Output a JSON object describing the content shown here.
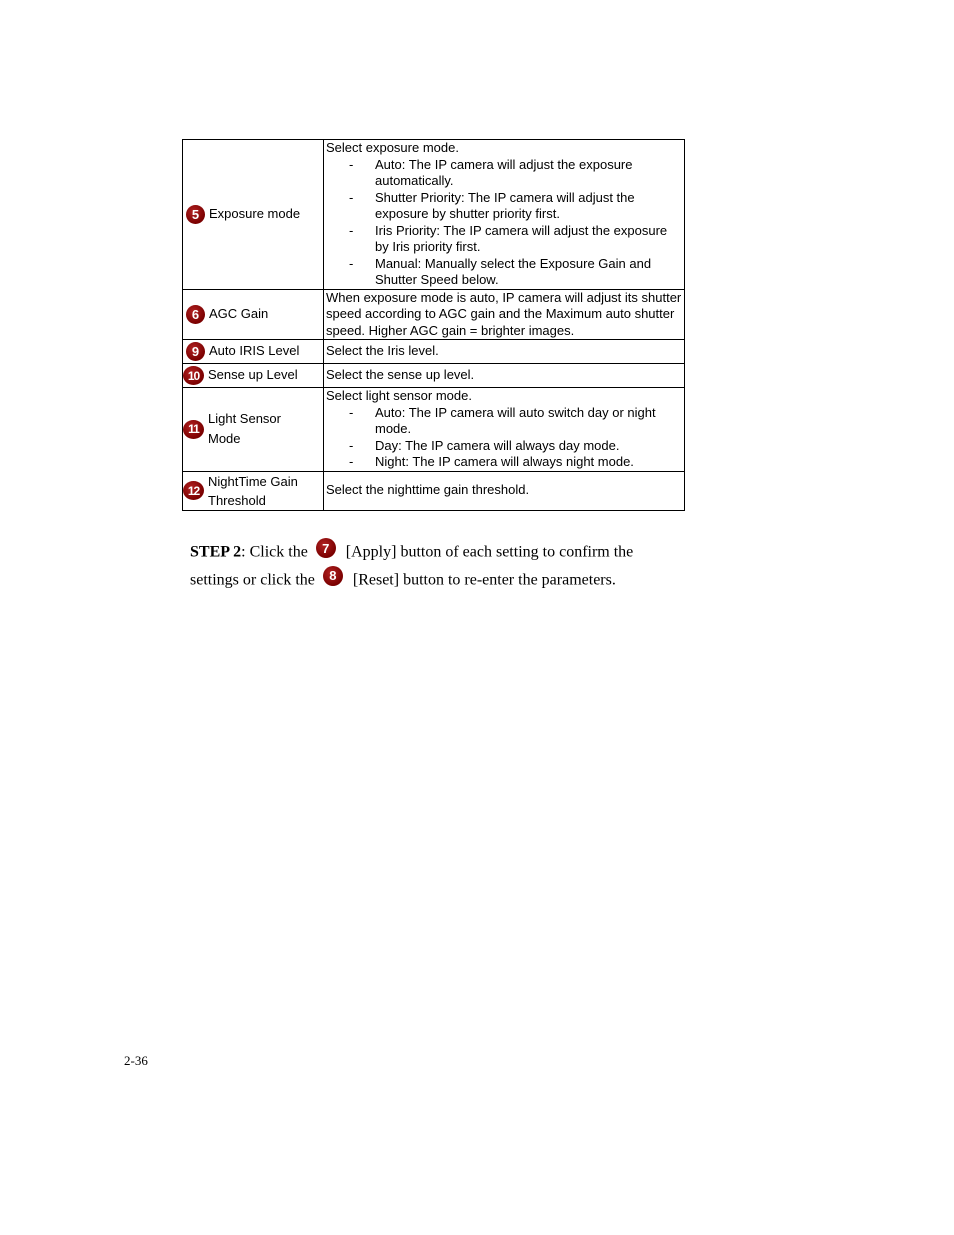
{
  "table": {
    "rows": [
      {
        "badge": "5",
        "name": "Exposure mode",
        "intro": "Select exposure mode.",
        "items": [
          "Auto: The IP camera will adjust the exposure automatically.",
          "Shutter Priority: The IP camera will adjust the exposure by shutter priority first.",
          "Iris Priority: The IP camera will adjust the exposure by Iris priority first.",
          "Manual: Manually select the Exposure Gain and Shutter Speed below."
        ]
      },
      {
        "badge": "6",
        "name": "AGC Gain",
        "intro": "When exposure mode is auto, IP camera will adjust its shutter speed according to AGC gain and the Maximum auto shutter speed. Higher AGC gain = brighter images."
      },
      {
        "badge": "9",
        "name": "Auto IRIS Level",
        "intro": "Select the Iris level."
      },
      {
        "badge": "10",
        "name": "Sense up Level",
        "intro": "Select the sense up level."
      },
      {
        "badge": "11",
        "name": "Light Sensor Mode",
        "intro": "Select light sensor mode.",
        "items": [
          "Auto: The IP camera will auto switch day or night mode.",
          "Day: The IP camera will always day mode.",
          "Night: The IP camera will always night mode."
        ]
      },
      {
        "badge": "12",
        "name": "NightTime Gain Threshold",
        "intro": "Select the nighttime gain threshold."
      }
    ]
  },
  "step": {
    "label": "STEP 2",
    "part1": ": Click the ",
    "badge_apply": "7",
    "part2": " [Apply] button of each setting to confirm the settings or click the ",
    "badge_reset": "8",
    "part3": " [Reset] button to re-enter the parameters."
  },
  "footer": {
    "page_number": "2-36"
  },
  "colors": {
    "badge": "#8b0000",
    "text": "#000000"
  }
}
